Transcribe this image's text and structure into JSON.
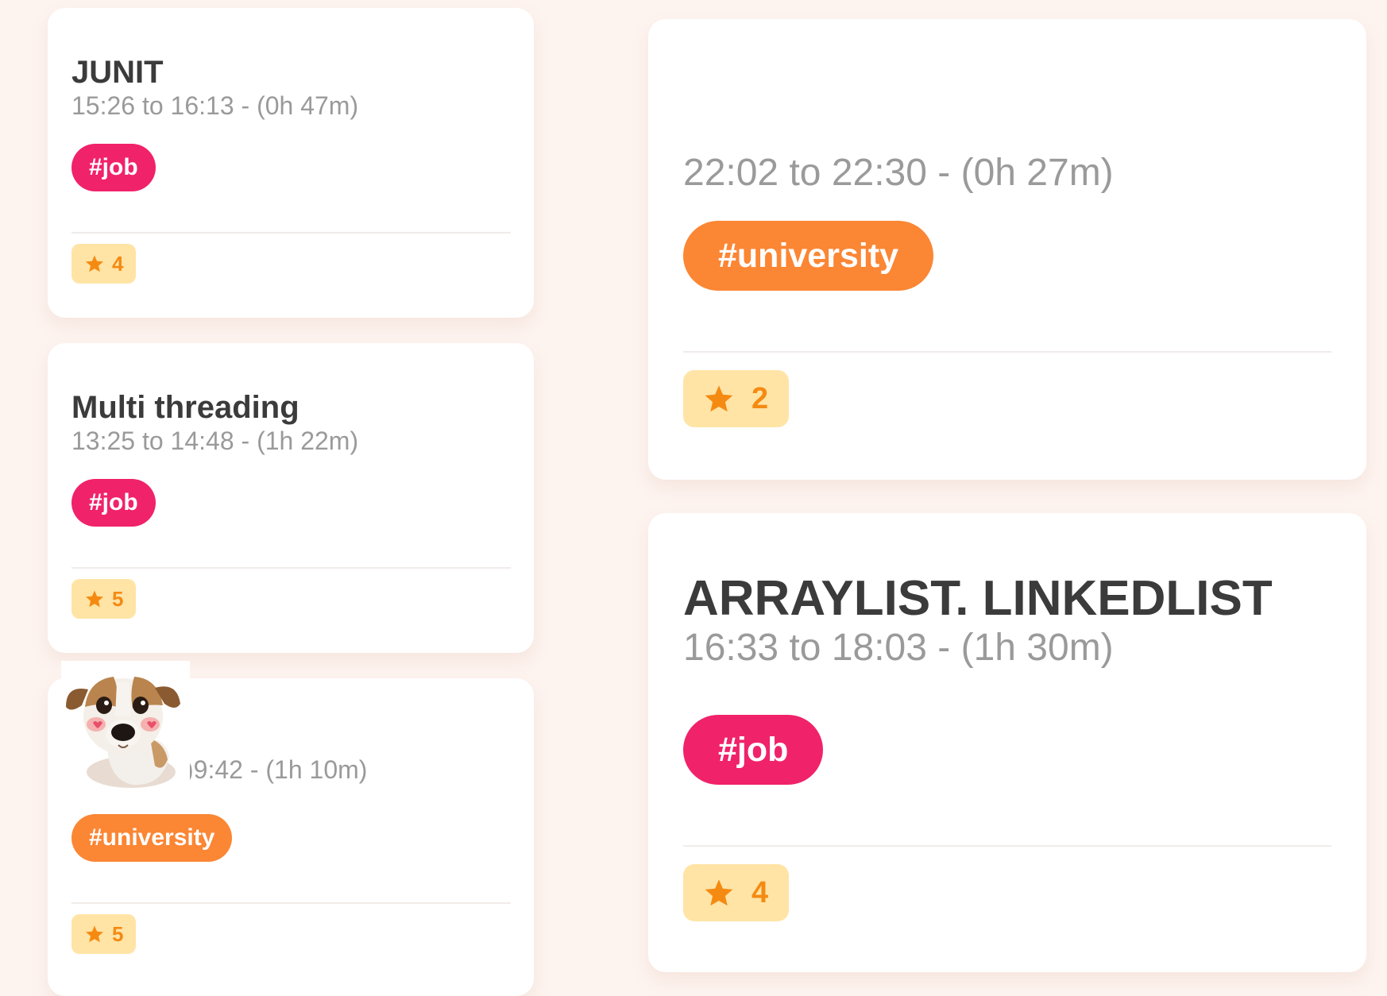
{
  "colors": {
    "background": "#fdf3ef",
    "card": "#ffffff",
    "tag_job": "#f0226a",
    "tag_university": "#fb8634",
    "rating_bg": "#ffe4a6",
    "rating_text": "#f58a12",
    "title_text": "#3b3b3b",
    "time_text": "#9a9a9a"
  },
  "left_cards": [
    {
      "title": "JUNIT",
      "time": "15:26 to 16:13 - (0h 47m)",
      "tag": "#job",
      "rating": "4",
      "rating_icon": "star-icon"
    },
    {
      "title": "Multi threading",
      "time": "13:25 to 14:48 - (1h 22m)",
      "tag": "#job",
      "rating": "5",
      "rating_icon": "star-icon"
    },
    {
      "title": "",
      "time": ")9:42 - (1h 10m)",
      "tag": "#university",
      "rating": "5",
      "rating_icon": "star-icon",
      "sticker": "dog-sticker-icon"
    }
  ],
  "right_cards": [
    {
      "title": "",
      "time": "22:02 to 22:30 - (0h 27m)",
      "tag": "#university",
      "rating": "2",
      "rating_icon": "star-icon"
    },
    {
      "title": "ARRAYLIST. LINKEDLIST",
      "time": "16:33 to 18:03 - (1h 30m)",
      "tag": "#job",
      "rating": "4",
      "rating_icon": "star-icon"
    }
  ]
}
